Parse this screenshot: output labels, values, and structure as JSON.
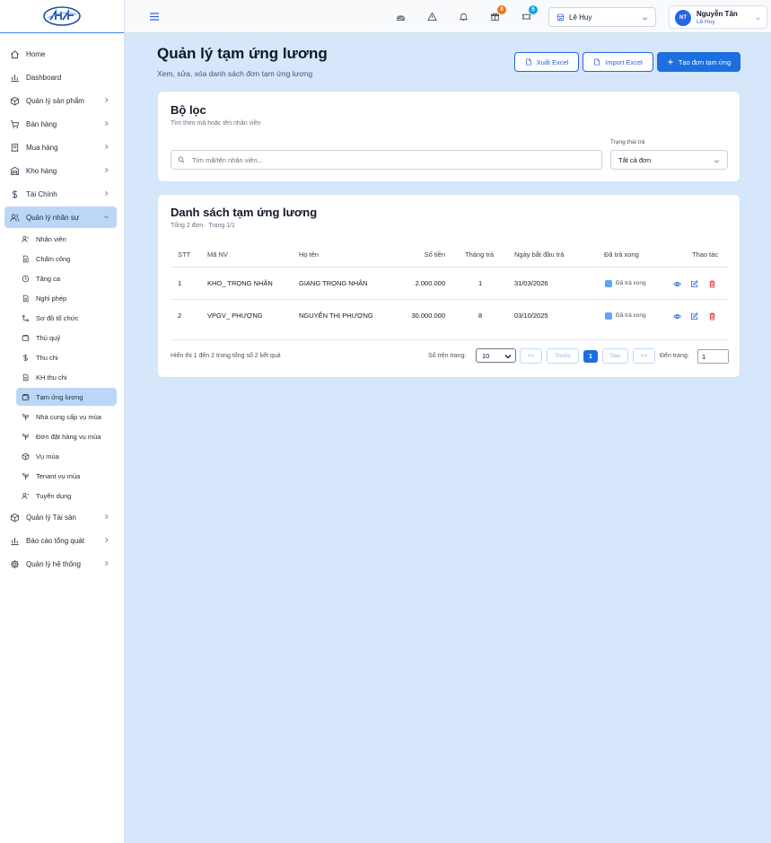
{
  "sidebar": {
    "items": [
      {
        "label": "Home",
        "icon": "home-icon"
      },
      {
        "label": "Dashboard",
        "icon": "bar-chart-icon"
      },
      {
        "label": "Quản lý sản phẩm",
        "icon": "box-icon"
      },
      {
        "label": "Bán hàng",
        "icon": "cart-icon"
      },
      {
        "label": "Mua hàng",
        "icon": "receipt-icon"
      },
      {
        "label": "Kho hàng",
        "icon": "warehouse-icon"
      },
      {
        "label": "Tài Chính",
        "icon": "dollar-icon"
      },
      {
        "label": "Quản lý nhân sự",
        "icon": "users-icon"
      },
      {
        "label": "Quản lý Tài sản",
        "icon": "box-icon"
      },
      {
        "label": "Báo cáo tổng quát",
        "icon": "bar-chart-icon"
      },
      {
        "label": "Quản lý hệ thống",
        "icon": "gear-icon"
      }
    ],
    "hr_items": [
      {
        "label": "Nhân viên",
        "icon": "users-icon"
      },
      {
        "label": "Chấm công",
        "icon": "document-icon"
      },
      {
        "label": "Tăng ca",
        "icon": "clock-icon"
      },
      {
        "label": "Nghỉ phép",
        "icon": "document-icon"
      },
      {
        "label": "Sơ đồ tổ chức",
        "icon": "org-chart-icon"
      },
      {
        "label": "Thủ quỹ",
        "icon": "wallet-icon"
      },
      {
        "label": "Thu chi",
        "icon": "dollar-icon"
      },
      {
        "label": "KH thu chi",
        "icon": "document-icon"
      },
      {
        "label": "Tạm ứng lương",
        "icon": "wallet-icon"
      },
      {
        "label": "Nhà cung cấp vụ mùa",
        "icon": "sprout-icon"
      },
      {
        "label": "Đơn đặt hàng vụ mùa",
        "icon": "sprout-icon"
      },
      {
        "label": "Vụ mùa",
        "icon": "box-icon"
      },
      {
        "label": "Tenant vụ mùa",
        "icon": "sprout-icon"
      },
      {
        "label": "Tuyển dụng",
        "icon": "users-icon"
      }
    ]
  },
  "topbar": {
    "badges": {
      "gift": "8",
      "ticket": "5"
    },
    "badge_colors": {
      "gift": "#f97316",
      "ticket": "#0ea5e9"
    },
    "branch": "Lê Huy",
    "user": {
      "initials": "NT",
      "name": "Nguyễn Tấn",
      "branch": "Lê Huy"
    }
  },
  "header": {
    "title": "Quản lý tạm ứng lương",
    "subtitle": "Xem, sửa, xóa danh sách đơn tạm ứng lương",
    "export_label": "Xuất Excel",
    "import_label": "Import Excel",
    "create_label": "Tạo đơn tạm ứng"
  },
  "filter": {
    "title": "Bộ lọc",
    "subtitle": "Tìm theo mã hoặc tên nhân viên",
    "search_placeholder": "Tìm mã/tên nhân viên...",
    "status_label": "Trạng thái trả",
    "status_value": "Tất cả đơn"
  },
  "list": {
    "title": "Danh sách tạm ứng lương",
    "subtitle": "Tổng 2 đơn · Trang 1/1",
    "columns": [
      "STT",
      "Mã NV",
      "Họ tên",
      "Số tiền",
      "Tháng trả",
      "Ngày bắt đầu trả",
      "Đã trả xong",
      "Thao tác"
    ],
    "rows": [
      {
        "stt": "1",
        "code": "KHO_ TRỌNG NHÂN",
        "name": "GIANG TRỌNG NHÂN",
        "amount": "2.000.000",
        "months": "1",
        "start": "31/03/2026",
        "paid": "Đã trả xong"
      },
      {
        "stt": "2",
        "code": "VPGV_ PHƯỢNG",
        "name": "NGUYỄN THỊ PHƯỢNG",
        "amount": "30.000.000",
        "months": "8",
        "start": "03/10/2025",
        "paid": "Đã trả xong"
      }
    ],
    "footer_info": "Hiển thị 1 đến 2 trong tổng số 2 kết quả",
    "per_page_label": "Số trên trang:",
    "per_page_value": "10",
    "first_label": "<<",
    "prev_label": "Trước",
    "current_page": "1",
    "next_label": "Sau",
    "last_label": ">>",
    "goto_label": "Đến trang:",
    "goto_value": "1"
  }
}
